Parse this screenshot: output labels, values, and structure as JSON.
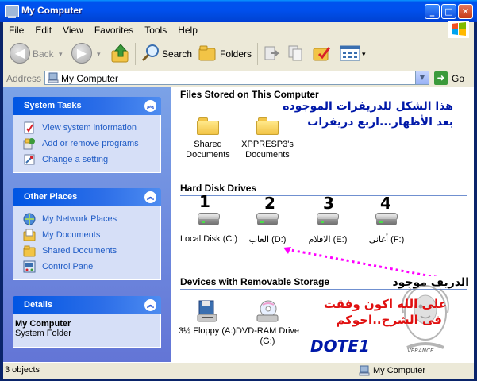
{
  "window": {
    "title": "My Computer",
    "controls": {
      "minimize": "_",
      "maximize": "□",
      "close": "✕"
    }
  },
  "menu": [
    "File",
    "Edit",
    "View",
    "Favorites",
    "Tools",
    "Help"
  ],
  "toolbar": {
    "back": "Back",
    "search": "Search",
    "folders": "Folders"
  },
  "address": {
    "label": "Address",
    "value": "My Computer",
    "go": "Go"
  },
  "left_panel": {
    "system_tasks": {
      "title": "System Tasks",
      "items": [
        "View system information",
        "Add or remove programs",
        "Change a setting"
      ]
    },
    "other_places": {
      "title": "Other Places",
      "items": [
        "My Network Places",
        "My Documents",
        "Shared Documents",
        "Control Panel"
      ]
    },
    "details": {
      "title": "Details",
      "name": "My Computer",
      "type": "System Folder"
    }
  },
  "main": {
    "files_section": {
      "title": "Files Stored on This Computer",
      "items": [
        "Shared Documents",
        "XPPRESP3's Documents"
      ]
    },
    "hdd_section": {
      "title": "Hard Disk Drives",
      "drives": [
        {
          "number": "1",
          "label": "Local Disk (C:)"
        },
        {
          "number": "2",
          "label": "العاب (D:)"
        },
        {
          "number": "3",
          "label": "الافلام (E:)"
        },
        {
          "number": "4",
          "label": "أغانى (F:)"
        }
      ]
    },
    "removable_section": {
      "title": "Devices with Removable Storage",
      "items": [
        "3½ Floppy (A:)",
        "DVD-RAM Drive (G:)"
      ]
    }
  },
  "annotations": {
    "line1": "هذا الشكل للدريفرات الموجوده",
    "line2": "بعد الأظهار...اربع دريفرات",
    "drive_present": "الدريف موجود",
    "thanks_line1": "على الله اكون وفقت",
    "thanks_line2": "فى الشرح..احوكم",
    "signature": "DOTE1",
    "watermark": "VERANCE"
  },
  "status": {
    "left": "3 objects",
    "right": "My Computer"
  },
  "colors": {
    "title_blue": "#0050ee",
    "taskpane_blue": "#7ba2e7",
    "link_blue": "#215dc6",
    "annot_blue": "#0018a8",
    "annot_red": "#e01010",
    "dotted_magenta": "#ff00ff"
  }
}
